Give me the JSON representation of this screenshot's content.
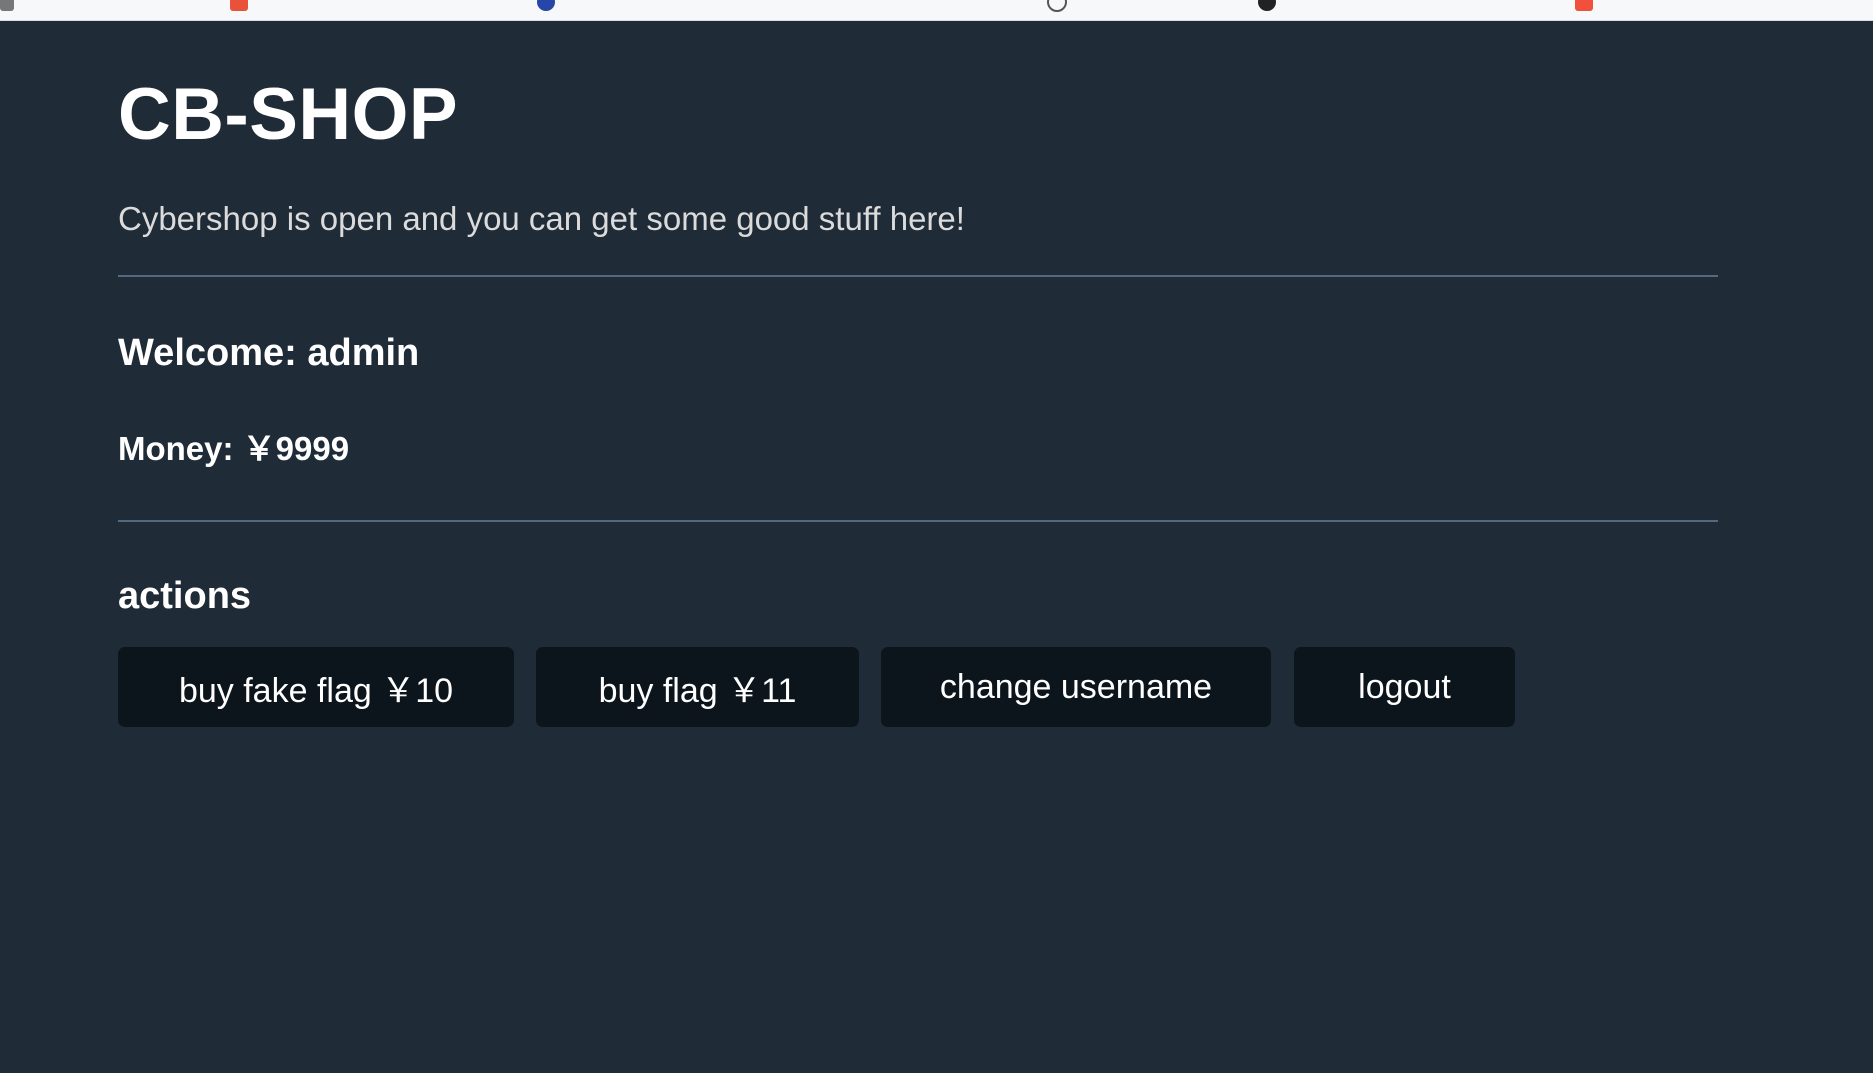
{
  "header": {
    "title": "CB-SHOP",
    "tagline": "Cybershop is open and you can get some good stuff here!"
  },
  "user": {
    "welcome": "Welcome: admin",
    "money": "Money: ￥9999"
  },
  "actions": {
    "heading": "actions",
    "buy_fake_flag": "buy fake flag ￥10",
    "buy_flag": "buy flag ￥11",
    "change_username": "change username",
    "logout": "logout"
  },
  "colors": {
    "background": "#202b38",
    "button_bg": "#0c151c",
    "divider": "#526980",
    "text": "#ffffff"
  }
}
